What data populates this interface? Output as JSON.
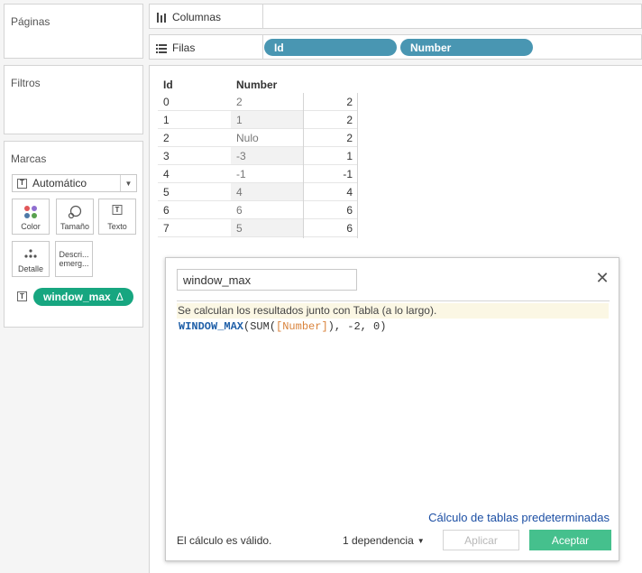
{
  "panels": {
    "pages_title": "Páginas",
    "filters_title": "Filtros",
    "marks": {
      "title": "Marcas",
      "mark_type": "Automático",
      "buttons": [
        {
          "name": "color",
          "label": "Color",
          "icon": "color-dots-icon"
        },
        {
          "name": "size",
          "label": "Tamaño",
          "icon": "size-icon"
        },
        {
          "name": "text",
          "label": "Texto",
          "icon": "text-icon"
        },
        {
          "name": "detail",
          "label": "Detalle",
          "icon": "detail-icon"
        },
        {
          "name": "tooltip",
          "label": "Descri... emerg...",
          "icon": "tooltip-icon"
        }
      ],
      "field_pill": "window_max",
      "field_pill_delta": "Δ"
    }
  },
  "shelves": {
    "columns_label": "Columnas",
    "rows_label": "Filas",
    "row_pills": [
      "Id",
      "Number"
    ]
  },
  "table": {
    "headers": {
      "id": "Id",
      "number": "Number"
    },
    "rows": [
      {
        "id": "0",
        "number": "2",
        "value": "2"
      },
      {
        "id": "1",
        "number": "1",
        "value": "2"
      },
      {
        "id": "2",
        "number": "Nulo",
        "value": "2"
      },
      {
        "id": "3",
        "number": "-3",
        "value": "1"
      },
      {
        "id": "4",
        "number": "-1",
        "value": "-1"
      },
      {
        "id": "5",
        "number": "4",
        "value": "4"
      },
      {
        "id": "6",
        "number": "6",
        "value": "6"
      },
      {
        "id": "7",
        "number": "5",
        "value": "6"
      }
    ]
  },
  "dialog": {
    "calc_name": "window_max",
    "info": "Se calculan los resultados junto con Tabla (a lo largo).",
    "formula": {
      "fn": "WINDOW_MAX",
      "open": "(SUM(",
      "field": "[Number]",
      "close": "), -2, 0)"
    },
    "default_table_calc_link": "Cálculo de tablas predeterminadas",
    "status": "El cálculo es válido.",
    "dependency": "1 dependencia",
    "apply_label": "Aplicar",
    "ok_label": "Aceptar"
  },
  "colors": {
    "dimension_pill": "#4996b2",
    "measure_pill": "#17a680",
    "ok_button": "#45c08d",
    "link": "#1c4fa4",
    "info_bar": "#fbf7e4"
  }
}
